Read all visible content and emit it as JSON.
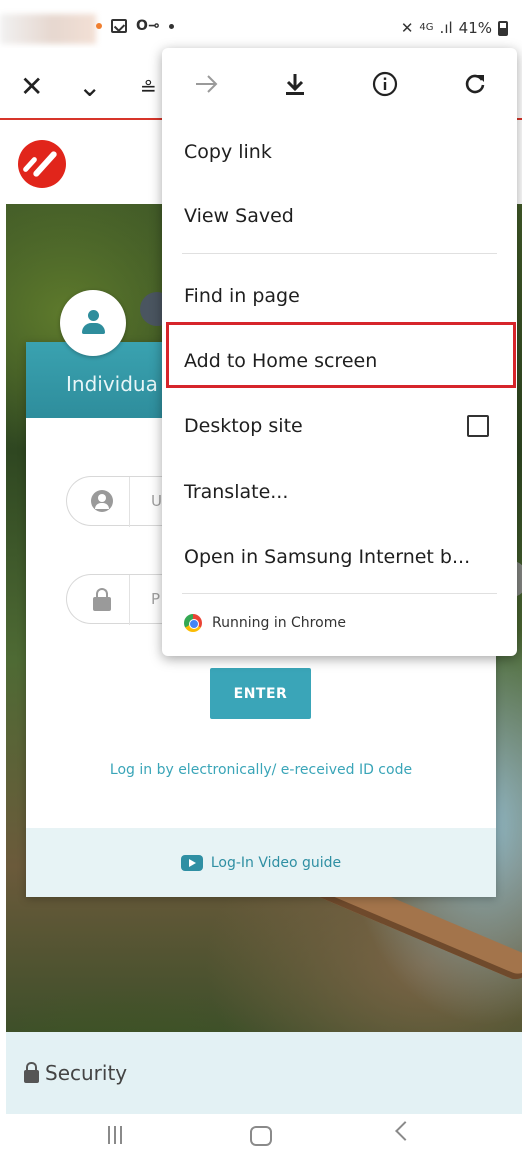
{
  "status_bar": {
    "right_text": "41%"
  },
  "toolbar": {
    "close_icon": "close-icon",
    "dropdown_icon": "chevron-down-icon"
  },
  "login_card": {
    "tab_individual": "Individua",
    "username_placeholder": "U",
    "password_placeholder": "P",
    "enter_label": "ENTER",
    "alt_login_link": "Log in by electronically/ e-received ID code",
    "video_guide_label": "Log-In Video guide"
  },
  "footer": {
    "security_label": "Security"
  },
  "overflow_menu": {
    "top_icons": [
      "forward-icon",
      "download-icon",
      "info-icon",
      "refresh-icon"
    ],
    "items": [
      {
        "label": "Copy link"
      },
      {
        "label": "View Saved"
      },
      {
        "label": "Find in page"
      },
      {
        "label": "Add to Home screen",
        "highlighted": true
      },
      {
        "label": "Desktop site",
        "checked": false
      },
      {
        "label": "Translate..."
      },
      {
        "label": "Open in Samsung Internet b..."
      }
    ],
    "running_in": "Running in Chrome"
  },
  "colors": {
    "accent_teal": "#3aa5b8",
    "brand_red": "#e1251b",
    "highlight_red": "#d6252b"
  }
}
